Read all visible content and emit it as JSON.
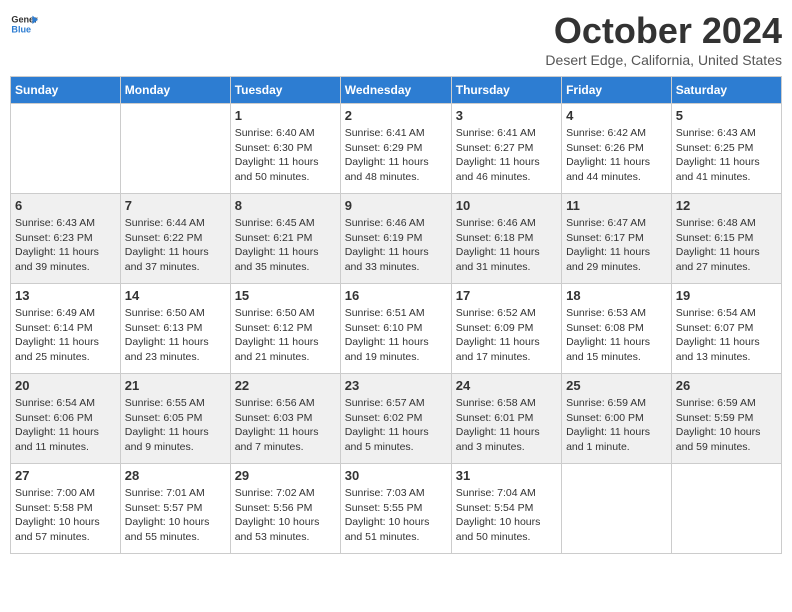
{
  "header": {
    "logo_line1": "General",
    "logo_line2": "Blue",
    "month_title": "October 2024",
    "location": "Desert Edge, California, United States"
  },
  "days_of_week": [
    "Sunday",
    "Monday",
    "Tuesday",
    "Wednesday",
    "Thursday",
    "Friday",
    "Saturday"
  ],
  "weeks": [
    [
      {
        "num": "",
        "sunrise": "",
        "sunset": "",
        "daylight": ""
      },
      {
        "num": "",
        "sunrise": "",
        "sunset": "",
        "daylight": ""
      },
      {
        "num": "1",
        "sunrise": "Sunrise: 6:40 AM",
        "sunset": "Sunset: 6:30 PM",
        "daylight": "Daylight: 11 hours and 50 minutes."
      },
      {
        "num": "2",
        "sunrise": "Sunrise: 6:41 AM",
        "sunset": "Sunset: 6:29 PM",
        "daylight": "Daylight: 11 hours and 48 minutes."
      },
      {
        "num": "3",
        "sunrise": "Sunrise: 6:41 AM",
        "sunset": "Sunset: 6:27 PM",
        "daylight": "Daylight: 11 hours and 46 minutes."
      },
      {
        "num": "4",
        "sunrise": "Sunrise: 6:42 AM",
        "sunset": "Sunset: 6:26 PM",
        "daylight": "Daylight: 11 hours and 44 minutes."
      },
      {
        "num": "5",
        "sunrise": "Sunrise: 6:43 AM",
        "sunset": "Sunset: 6:25 PM",
        "daylight": "Daylight: 11 hours and 41 minutes."
      }
    ],
    [
      {
        "num": "6",
        "sunrise": "Sunrise: 6:43 AM",
        "sunset": "Sunset: 6:23 PM",
        "daylight": "Daylight: 11 hours and 39 minutes."
      },
      {
        "num": "7",
        "sunrise": "Sunrise: 6:44 AM",
        "sunset": "Sunset: 6:22 PM",
        "daylight": "Daylight: 11 hours and 37 minutes."
      },
      {
        "num": "8",
        "sunrise": "Sunrise: 6:45 AM",
        "sunset": "Sunset: 6:21 PM",
        "daylight": "Daylight: 11 hours and 35 minutes."
      },
      {
        "num": "9",
        "sunrise": "Sunrise: 6:46 AM",
        "sunset": "Sunset: 6:19 PM",
        "daylight": "Daylight: 11 hours and 33 minutes."
      },
      {
        "num": "10",
        "sunrise": "Sunrise: 6:46 AM",
        "sunset": "Sunset: 6:18 PM",
        "daylight": "Daylight: 11 hours and 31 minutes."
      },
      {
        "num": "11",
        "sunrise": "Sunrise: 6:47 AM",
        "sunset": "Sunset: 6:17 PM",
        "daylight": "Daylight: 11 hours and 29 minutes."
      },
      {
        "num": "12",
        "sunrise": "Sunrise: 6:48 AM",
        "sunset": "Sunset: 6:15 PM",
        "daylight": "Daylight: 11 hours and 27 minutes."
      }
    ],
    [
      {
        "num": "13",
        "sunrise": "Sunrise: 6:49 AM",
        "sunset": "Sunset: 6:14 PM",
        "daylight": "Daylight: 11 hours and 25 minutes."
      },
      {
        "num": "14",
        "sunrise": "Sunrise: 6:50 AM",
        "sunset": "Sunset: 6:13 PM",
        "daylight": "Daylight: 11 hours and 23 minutes."
      },
      {
        "num": "15",
        "sunrise": "Sunrise: 6:50 AM",
        "sunset": "Sunset: 6:12 PM",
        "daylight": "Daylight: 11 hours and 21 minutes."
      },
      {
        "num": "16",
        "sunrise": "Sunrise: 6:51 AM",
        "sunset": "Sunset: 6:10 PM",
        "daylight": "Daylight: 11 hours and 19 minutes."
      },
      {
        "num": "17",
        "sunrise": "Sunrise: 6:52 AM",
        "sunset": "Sunset: 6:09 PM",
        "daylight": "Daylight: 11 hours and 17 minutes."
      },
      {
        "num": "18",
        "sunrise": "Sunrise: 6:53 AM",
        "sunset": "Sunset: 6:08 PM",
        "daylight": "Daylight: 11 hours and 15 minutes."
      },
      {
        "num": "19",
        "sunrise": "Sunrise: 6:54 AM",
        "sunset": "Sunset: 6:07 PM",
        "daylight": "Daylight: 11 hours and 13 minutes."
      }
    ],
    [
      {
        "num": "20",
        "sunrise": "Sunrise: 6:54 AM",
        "sunset": "Sunset: 6:06 PM",
        "daylight": "Daylight: 11 hours and 11 minutes."
      },
      {
        "num": "21",
        "sunrise": "Sunrise: 6:55 AM",
        "sunset": "Sunset: 6:05 PM",
        "daylight": "Daylight: 11 hours and 9 minutes."
      },
      {
        "num": "22",
        "sunrise": "Sunrise: 6:56 AM",
        "sunset": "Sunset: 6:03 PM",
        "daylight": "Daylight: 11 hours and 7 minutes."
      },
      {
        "num": "23",
        "sunrise": "Sunrise: 6:57 AM",
        "sunset": "Sunset: 6:02 PM",
        "daylight": "Daylight: 11 hours and 5 minutes."
      },
      {
        "num": "24",
        "sunrise": "Sunrise: 6:58 AM",
        "sunset": "Sunset: 6:01 PM",
        "daylight": "Daylight: 11 hours and 3 minutes."
      },
      {
        "num": "25",
        "sunrise": "Sunrise: 6:59 AM",
        "sunset": "Sunset: 6:00 PM",
        "daylight": "Daylight: 11 hours and 1 minute."
      },
      {
        "num": "26",
        "sunrise": "Sunrise: 6:59 AM",
        "sunset": "Sunset: 5:59 PM",
        "daylight": "Daylight: 10 hours and 59 minutes."
      }
    ],
    [
      {
        "num": "27",
        "sunrise": "Sunrise: 7:00 AM",
        "sunset": "Sunset: 5:58 PM",
        "daylight": "Daylight: 10 hours and 57 minutes."
      },
      {
        "num": "28",
        "sunrise": "Sunrise: 7:01 AM",
        "sunset": "Sunset: 5:57 PM",
        "daylight": "Daylight: 10 hours and 55 minutes."
      },
      {
        "num": "29",
        "sunrise": "Sunrise: 7:02 AM",
        "sunset": "Sunset: 5:56 PM",
        "daylight": "Daylight: 10 hours and 53 minutes."
      },
      {
        "num": "30",
        "sunrise": "Sunrise: 7:03 AM",
        "sunset": "Sunset: 5:55 PM",
        "daylight": "Daylight: 10 hours and 51 minutes."
      },
      {
        "num": "31",
        "sunrise": "Sunrise: 7:04 AM",
        "sunset": "Sunset: 5:54 PM",
        "daylight": "Daylight: 10 hours and 50 minutes."
      },
      {
        "num": "",
        "sunrise": "",
        "sunset": "",
        "daylight": ""
      },
      {
        "num": "",
        "sunrise": "",
        "sunset": "",
        "daylight": ""
      }
    ]
  ]
}
